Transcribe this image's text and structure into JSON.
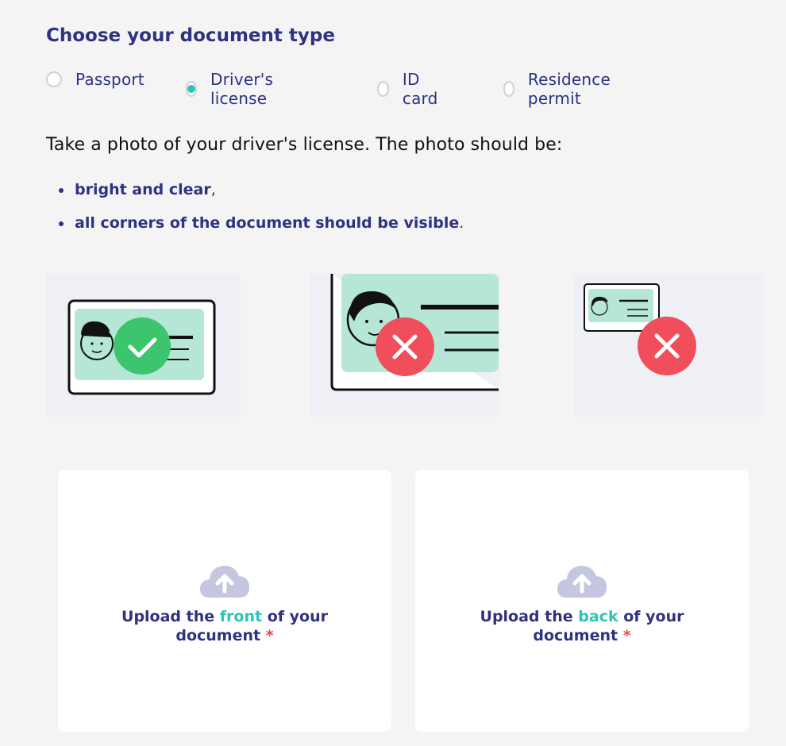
{
  "heading": "Choose your document type",
  "doc_types": [
    {
      "label": "Passport",
      "selected": false
    },
    {
      "label": "Driver's license",
      "selected": true
    },
    {
      "label": "ID card",
      "selected": false
    },
    {
      "label": "Residence permit",
      "selected": false
    }
  ],
  "instruction": "Take a photo of your driver's license. The photo should be:",
  "requirements": [
    {
      "text": "bright and clear",
      "punct": ","
    },
    {
      "text": "all corners of the document should be visible",
      "punct": "."
    }
  ],
  "examples": [
    {
      "status": "correct",
      "icon": "check-icon"
    },
    {
      "status": "cropped",
      "icon": "cross-icon"
    },
    {
      "status": "too-small",
      "icon": "cross-icon"
    }
  ],
  "uploads": {
    "front": {
      "prefix": "Upload the ",
      "highlight": "front",
      "suffix": " of your document",
      "required": "*"
    },
    "back": {
      "prefix": "Upload the ",
      "highlight": "back",
      "suffix": " of your document",
      "required": "*"
    }
  },
  "colors": {
    "brand": "#2e3280",
    "accent": "#2bc5b4",
    "card_green": "#b6e6d5",
    "success": "#3dc46e",
    "error": "#ef4e5a",
    "required": "#e54b4b"
  }
}
